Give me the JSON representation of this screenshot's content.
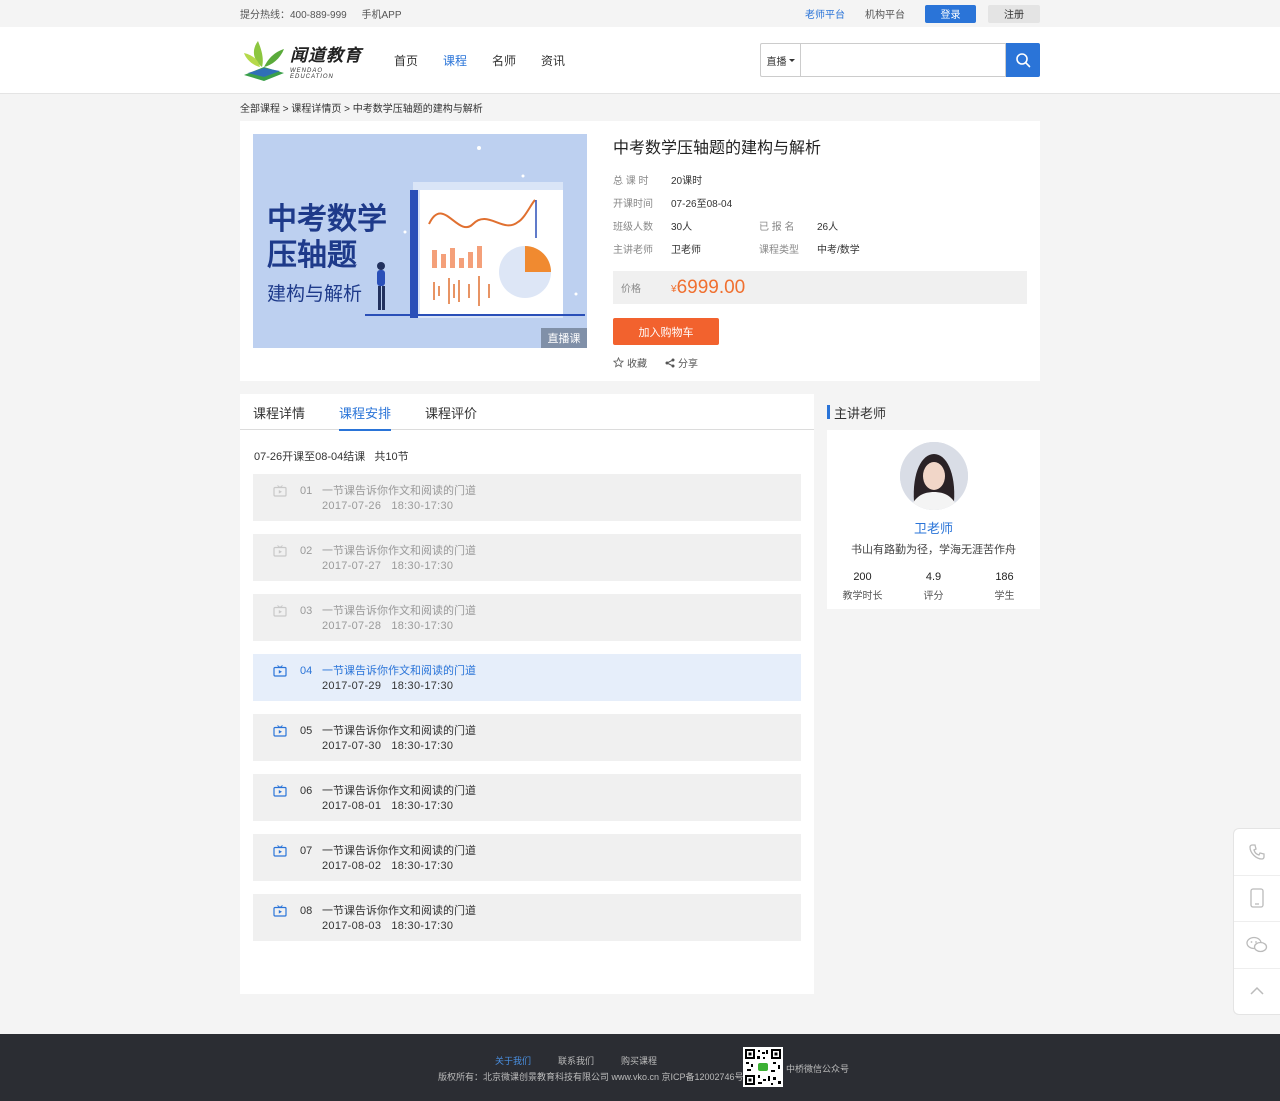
{
  "topbar": {
    "hotline": "提分热线：400-889-999",
    "app": "手机APP",
    "teacher_platform": "老师平台",
    "org_platform": "机构平台",
    "login": "登录",
    "register": "注册"
  },
  "header": {
    "logo_cn": "闻道教育",
    "logo_en": "WENDAO EDUCATION",
    "nav": [
      "首页",
      "课程",
      "名师",
      "资讯"
    ],
    "nav_active": "课程",
    "search_type": "直播",
    "search_placeholder": ""
  },
  "breadcrumb": "全部课程 > 课程详情页 > 中考数学压轴题的建构与解析",
  "course": {
    "cover_title_1": "中考数学",
    "cover_title_2": "压轴题",
    "cover_subtitle": "建构与解析",
    "cover_badge": "直播课",
    "title": "中考数学压轴题的建构与解析",
    "fields": {
      "hours_k": "总 课 时",
      "hours_v": "20课时",
      "time_k": "开课时间",
      "time_v": "07-26至08-04",
      "class_k": "班级人数",
      "class_v": "30人",
      "enrolled_k": "已 报 名",
      "enrolled_v": "26人",
      "teacher_k": "主讲老师",
      "teacher_v": "卫老师",
      "type_k": "课程类型",
      "type_v": "中考/数学"
    },
    "price_k": "价格",
    "price_currency": "¥",
    "price_v": "6999.00",
    "add_cart": "加入购物车",
    "favorite": "收藏",
    "share": "分享"
  },
  "tabs": [
    "课程详情",
    "课程安排",
    "课程评价"
  ],
  "schedule": {
    "summary": "07-26开课至08-04结课   共10节",
    "lessons": [
      {
        "no": "01",
        "title": "一节课告诉你作文和阅读的门道",
        "time": "2017-07-26   18:30-17:30",
        "state": "done"
      },
      {
        "no": "02",
        "title": "一节课告诉你作文和阅读的门道",
        "time": "2017-07-27   18:30-17:30",
        "state": "done"
      },
      {
        "no": "03",
        "title": "一节课告诉你作文和阅读的门道",
        "time": "2017-07-28   18:30-17:30",
        "state": "done"
      },
      {
        "no": "04",
        "title": "一节课告诉你作文和阅读的门道",
        "time": "2017-07-29   18:30-17:30",
        "state": "current"
      },
      {
        "no": "05",
        "title": "一节课告诉你作文和阅读的门道",
        "time": "2017-07-30   18:30-17:30",
        "state": "todo"
      },
      {
        "no": "06",
        "title": "一节课告诉你作文和阅读的门道",
        "time": "2017-08-01   18:30-17:30",
        "state": "todo"
      },
      {
        "no": "07",
        "title": "一节课告诉你作文和阅读的门道",
        "time": "2017-08-02   18:30-17:30",
        "state": "todo"
      },
      {
        "no": "08",
        "title": "一节课告诉你作文和阅读的门道",
        "time": "2017-08-03   18:30-17:30",
        "state": "todo"
      }
    ]
  },
  "teacher": {
    "heading": "主讲老师",
    "name": "卫老师",
    "motto": "书山有路勤为径，学海无涯苦作舟",
    "stats": [
      {
        "n": "200",
        "l": "教学时长"
      },
      {
        "n": "4.9",
        "l": "评分"
      },
      {
        "n": "186",
        "l": "学生"
      }
    ]
  },
  "footer": {
    "links": [
      "关于我们",
      "联系我们",
      "购买课程"
    ],
    "copyright": "版权所有：北京微课创景教育科技有限公司 www.vko.cn 京ICP备12002746号",
    "qr_label": "中桥微信公众号"
  },
  "colors": {
    "primary": "#2a74d8",
    "accent": "#f2622e",
    "footer_bg": "#2b2d33"
  }
}
